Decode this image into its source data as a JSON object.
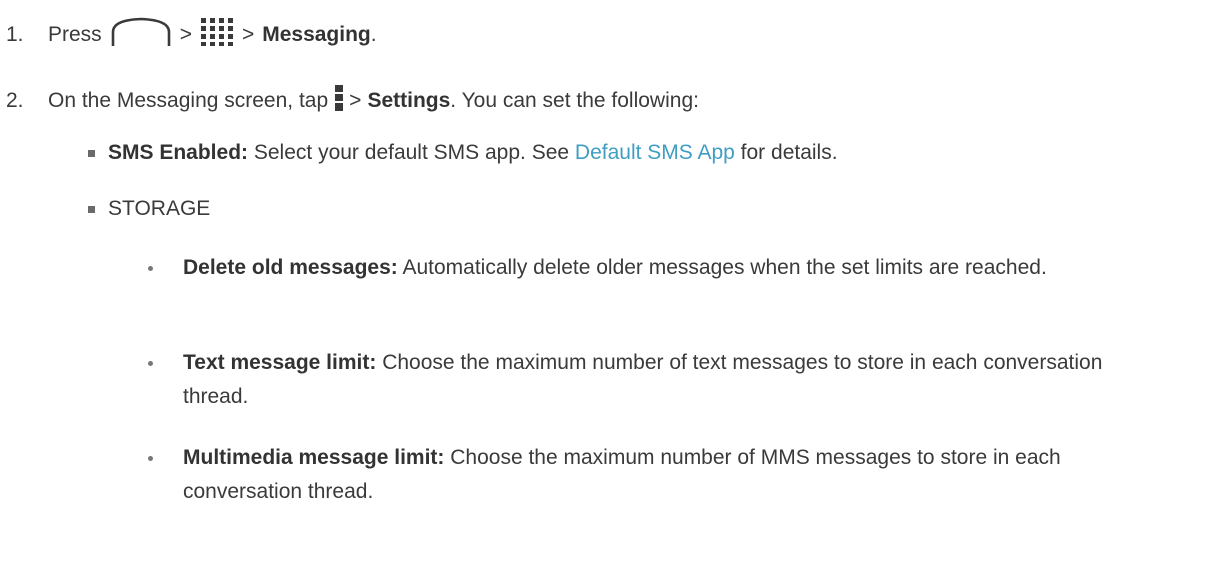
{
  "step1": {
    "number": "1.",
    "text_before": "Press",
    "sep1": ">",
    "sep2": ">",
    "destination": "Messaging",
    "period": ".",
    "home_icon": "home-key-icon",
    "apps_icon": "apps-grid-icon"
  },
  "step2": {
    "number": "2.",
    "text_before": "On the Messaging screen, tap",
    "sep": ">",
    "destination": "Settings",
    "text_after": ". You can set the following:",
    "menu_icon": "menu-kebab-icon"
  },
  "sms": {
    "label": "SMS Enabled:",
    "text_before": "Select your default SMS app. See",
    "link": "Default SMS App",
    "text_after": "for details."
  },
  "storage": {
    "heading": "STORAGE",
    "items": [
      {
        "label": "Delete old messages:",
        "text": "Automatically delete older messages when the set limits are reached."
      },
      {
        "label": "Text message limit:",
        "text": "Choose the maximum number of text messages to store in each conversation thread."
      },
      {
        "label": "Multimedia message limit:",
        "text": "Choose the maximum number of MMS messages to store in each conversation thread."
      }
    ]
  }
}
